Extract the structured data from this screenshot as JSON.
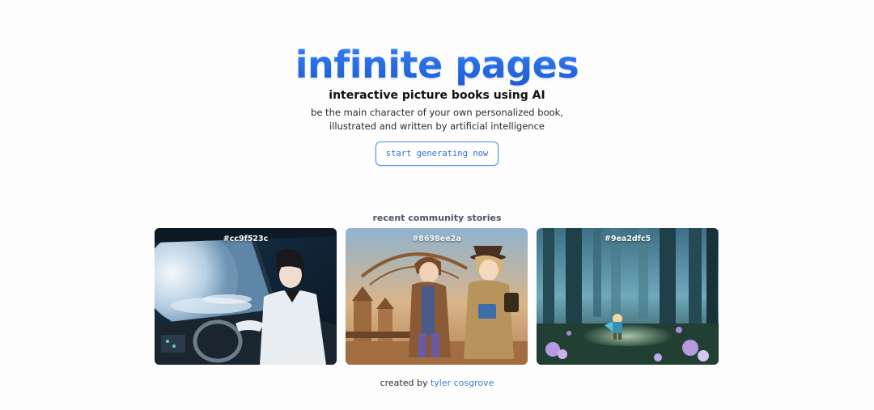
{
  "hero": {
    "title": "infinite pages",
    "subtitle": "interactive picture books using AI",
    "desc_line1": "be the main character of your own personalized book,",
    "desc_line2": "illustrated and written by artificial intelligence",
    "cta_label": "start generating now"
  },
  "community": {
    "heading": "recent community stories",
    "stories": [
      {
        "id": "#cc9f523c",
        "scene": "boy piloting a spaceship beside a moon"
      },
      {
        "id": "#8698ee2a",
        "scene": "two adventurers in a steampunk city"
      },
      {
        "id": "#9ea2dfc5",
        "scene": "small hero in a misty forest with glowing flowers"
      }
    ]
  },
  "footer": {
    "prefix": "created by",
    "author": "tyler cosgrove"
  },
  "colors": {
    "accent": "#2a6ff0",
    "button_border": "#4b8ff0",
    "link": "#3a7bd5"
  }
}
